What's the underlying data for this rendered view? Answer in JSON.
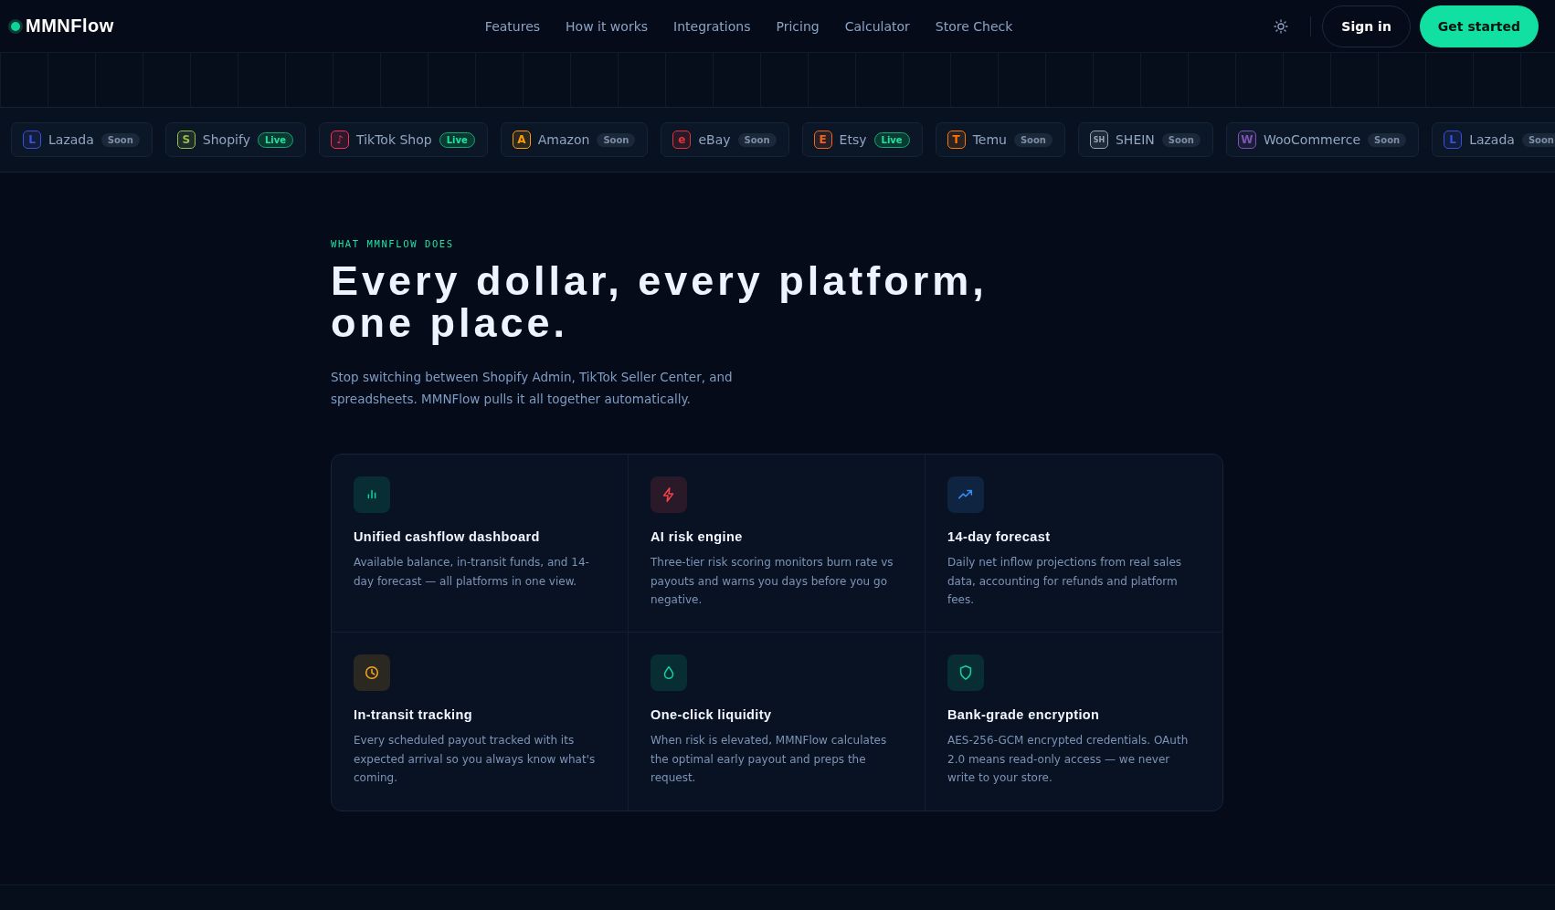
{
  "header": {
    "logo": "MMNFlow",
    "nav": [
      "Features",
      "How it works",
      "Integrations",
      "Pricing",
      "Calculator",
      "Store Check"
    ],
    "sign_in": "Sign in",
    "cta": "Get started"
  },
  "platforms": [
    {
      "icon": "L",
      "name": "Lazada",
      "status": "Soon",
      "kind": "soon",
      "color": "#3b4fd8"
    },
    {
      "icon": "S",
      "name": "Shopify",
      "status": "Live",
      "kind": "live",
      "color": "#95bf47"
    },
    {
      "icon": "♪",
      "name": "TikTok Shop",
      "status": "Live",
      "kind": "live",
      "color": "#fe2c55"
    },
    {
      "icon": "A",
      "name": "Amazon",
      "status": "Soon",
      "kind": "soon",
      "color": "#ff9900"
    },
    {
      "icon": "e",
      "name": "eBay",
      "status": "Soon",
      "kind": "soon",
      "color": "#e53238"
    },
    {
      "icon": "E",
      "name": "Etsy",
      "status": "Live",
      "kind": "live",
      "color": "#f1641e"
    },
    {
      "icon": "T",
      "name": "Temu",
      "status": "Soon",
      "kind": "soon",
      "color": "#fb7701"
    },
    {
      "icon": "SH",
      "name": "SHEIN",
      "status": "Soon",
      "kind": "soon",
      "color": "#9aa4b2"
    },
    {
      "icon": "W",
      "name": "WooCommerce",
      "status": "Soon",
      "kind": "soon",
      "color": "#7f54b3"
    },
    {
      "icon": "L",
      "name": "Lazada",
      "status": "Soon",
      "kind": "soon",
      "color": "#3b4fd8"
    }
  ],
  "section": {
    "eyebrow": "WHAT MMNFLOW DOES",
    "heading": [
      "Every dollar, every platform,",
      "one place."
    ],
    "lead": "Stop switching between Shopify Admin, TikTok Seller Center, and spreadsheets. MMNFlow pulls it all together automatically."
  },
  "features": [
    {
      "kind": "bars",
      "color": "#10d39a",
      "title": "Unified cashflow dashboard",
      "text": "Available balance, in-transit funds, and 14-day forecast — all platforms in one view."
    },
    {
      "kind": "bolt",
      "color": "#f0444b",
      "title": "AI risk engine",
      "text": "Three-tier risk scoring monitors burn rate vs payouts and warns you days before you go negative."
    },
    {
      "kind": "trend",
      "color": "#3b8df0",
      "title": "14-day forecast",
      "text": "Daily net inflow projections from real sales data, accounting for refunds and platform fees."
    },
    {
      "kind": "clock",
      "color": "#f5a623",
      "title": "In-transit tracking",
      "text": "Every scheduled payout tracked with its expected arrival so you always know what's coming."
    },
    {
      "kind": "drop",
      "color": "#10d39a",
      "title": "One-click liquidity",
      "text": "When risk is elevated, MMNFlow calculates the optimal early payout and preps the request."
    },
    {
      "kind": "shield",
      "color": "#10d39a",
      "title": "Bank-grade encryption",
      "text": "AES-256-GCM encrypted credentials. OAuth 2.0 means read-only access — we never write to your store."
    }
  ]
}
